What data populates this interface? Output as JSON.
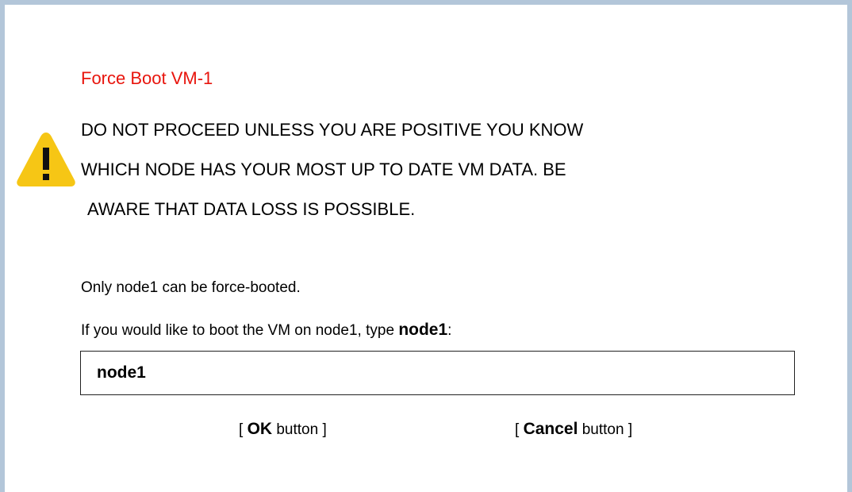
{
  "dialog": {
    "title": "Force Boot VM-1",
    "warning_lines": [
      "DO NOT PROCEED UNLESS YOU ARE POSITIVE YOU KNOW",
      "WHICH NODE HAS YOUR MOST UP TO DATE VM DATA. BE",
      "AWARE THAT DATA LOSS IS POSSIBLE."
    ],
    "warning_icon": "warning-triangle-icon",
    "info_line": "Only node1 can be force-booted.",
    "prompt": {
      "prefix": "If you would like to boot the VM on node1, type ",
      "keyword": "node1",
      "suffix": ":"
    },
    "input_value": "node1",
    "ok_button": {
      "open": "[ ",
      "label": "OK",
      "suffix": " button ]"
    },
    "cancel_button": {
      "open": "[ ",
      "label": "Cancel",
      "suffix": " button ]"
    }
  },
  "colors": {
    "title": "#e8150d",
    "frame_border": "#b3c6d9",
    "warning_icon_fill": "#f6c615"
  }
}
